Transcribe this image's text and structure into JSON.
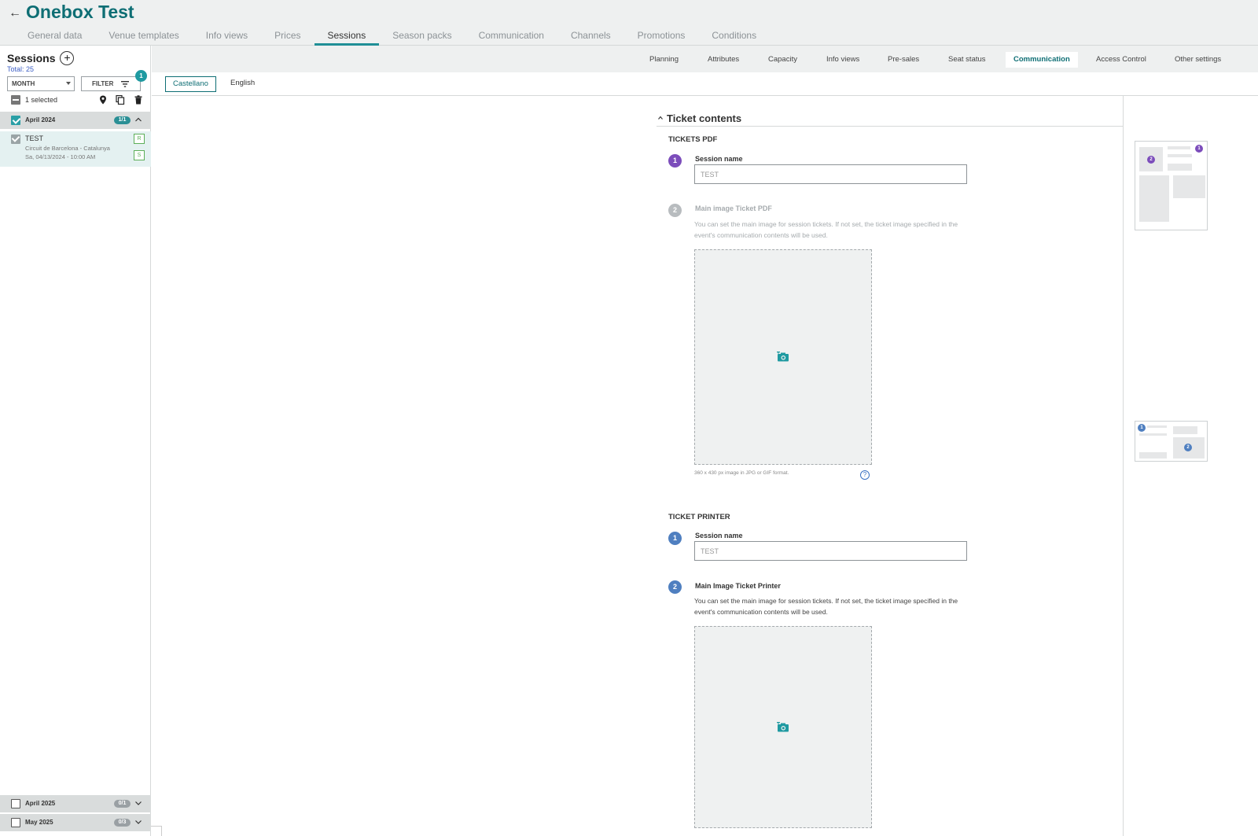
{
  "header": {
    "title": "Onebox Test",
    "tabs": [
      "General data",
      "Venue templates",
      "Info views",
      "Prices",
      "Sessions",
      "Season packs",
      "Communication",
      "Channels",
      "Promotions",
      "Conditions"
    ],
    "active_tab": "Sessions"
  },
  "sidebar": {
    "title": "Sessions",
    "total": "Total: 25",
    "view_select": "MONTH",
    "filter_label": "FILTER",
    "filter_count": "1",
    "selected_text": "1 selected",
    "groups": [
      {
        "label": "April 2024",
        "badge": "1/1",
        "checked": true
      },
      {
        "label": "April 2025",
        "badge": "0/1",
        "checked": false
      },
      {
        "label": "May 2025",
        "badge": "0/3",
        "checked": false
      }
    ],
    "session": {
      "name": "TEST",
      "venue": "Circuit de Barcelona - Catalunya",
      "date": "Sa, 04/13/2024 - 10:00 AM",
      "tags": [
        "R",
        "S"
      ]
    }
  },
  "subtabs": [
    "Planning",
    "Attributes",
    "Capacity",
    "Info views",
    "Pre-sales",
    "Seat status",
    "Communication",
    "Access Control",
    "Other settings"
  ],
  "active_subtab": "Communication",
  "languages": [
    "Castellano",
    "English"
  ],
  "active_language": "Castellano",
  "content": {
    "section_title": "Ticket contents",
    "pdf": {
      "heading": "TICKETS PDF",
      "step1": {
        "number": "1",
        "label": "Session name",
        "value": "TEST"
      },
      "step2": {
        "number": "2",
        "label": "Main image Ticket PDF",
        "description": "You can set the main image for session tickets. If not set, the ticket image specified in the event's communication contents will be used.",
        "hint": "360 x 430 px image in JPG or GIF format."
      }
    },
    "printer": {
      "heading": "TICKET PRINTER",
      "step1": {
        "number": "1",
        "label": "Session name",
        "value": "TEST"
      },
      "step2": {
        "number": "2",
        "label": "Main Image Ticket Printer",
        "description": "You can set the main image for session tickets. If not set, the ticket image specified in the event's communication contents will be used."
      }
    }
  },
  "previews": {
    "pdf_marks": [
      "1",
      "2"
    ],
    "printer_marks": [
      "1",
      "2"
    ]
  },
  "colors": {
    "brand": "#0e6e74",
    "accent": "#1f9aa1",
    "step_pdf": "#7c4dbb",
    "step_printer": "#4f7fc0"
  }
}
